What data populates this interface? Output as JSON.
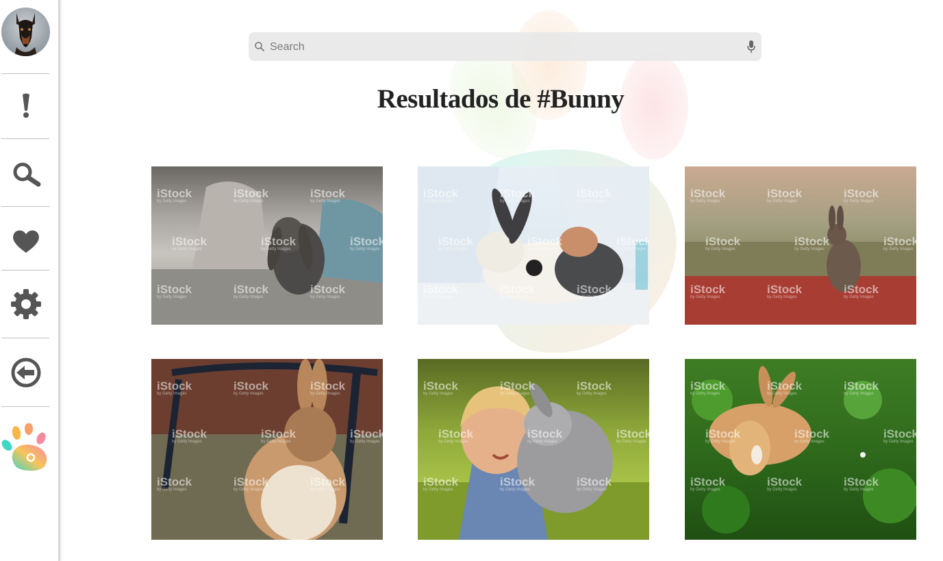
{
  "sidebar": {
    "avatar_alt": "User avatar",
    "items": [
      {
        "name": "notifications",
        "icon": "exclamation-icon"
      },
      {
        "name": "search",
        "icon": "search-icon"
      },
      {
        "name": "favorites",
        "icon": "heart-icon"
      },
      {
        "name": "settings",
        "icon": "gear-icon"
      },
      {
        "name": "logout",
        "icon": "logout-icon"
      },
      {
        "name": "home",
        "icon": "paw-logo-icon"
      }
    ]
  },
  "search": {
    "placeholder": "Search",
    "value": ""
  },
  "results": {
    "title": "Resultados de #Bunny",
    "photos": [
      {
        "subject": "lop-eared bunny on sofa"
      },
      {
        "subject": "vet examining bunny"
      },
      {
        "subject": "wild rabbit in red field"
      },
      {
        "subject": "bunny grooming under bench"
      },
      {
        "subject": "girl hugging bunny"
      },
      {
        "subject": "bunny in clover"
      }
    ],
    "watermark": "iStock",
    "watermark_sub": "by Getty Images"
  },
  "colors": {
    "icon_gray": "#5a5a5a",
    "paw_pink": "#f7a8b8",
    "paw_orange": "#f6a44a",
    "paw_teal": "#3fd6c4"
  }
}
